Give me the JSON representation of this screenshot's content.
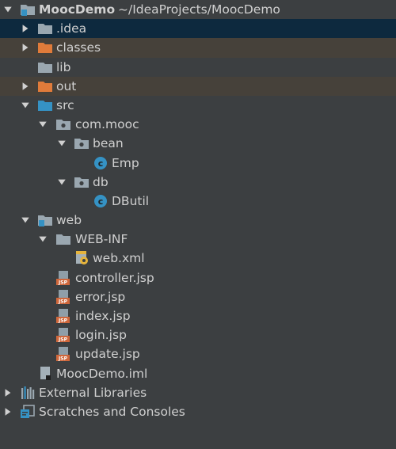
{
  "project": {
    "name": "MoocDemo",
    "path": "~/IdeaProjects/MoocDemo"
  },
  "tree": {
    "idea": ".idea",
    "classes": "classes",
    "lib": "lib",
    "out": "out",
    "src": "src",
    "com_mooc": "com.mooc",
    "bean": "bean",
    "emp": "Emp",
    "db": "db",
    "dbutil": "DButil",
    "web": "web",
    "web_inf": "WEB-INF",
    "web_xml": "web.xml",
    "controller_jsp": "controller.jsp",
    "error_jsp": "error.jsp",
    "index_jsp": "index.jsp",
    "login_jsp": "login.jsp",
    "update_jsp": "update.jsp",
    "iml": "MoocDemo.iml",
    "external_libraries": "External Libraries",
    "scratches": "Scratches and Consoles"
  },
  "colors": {
    "background": "#3c3f41",
    "selected_row": "#0d293e",
    "excluded_row": "#46413a",
    "folder_gray": "#9aa7b0",
    "folder_blue": "#3592c4",
    "folder_orange": "#e07b3a",
    "class_icon": "#3592c4"
  }
}
